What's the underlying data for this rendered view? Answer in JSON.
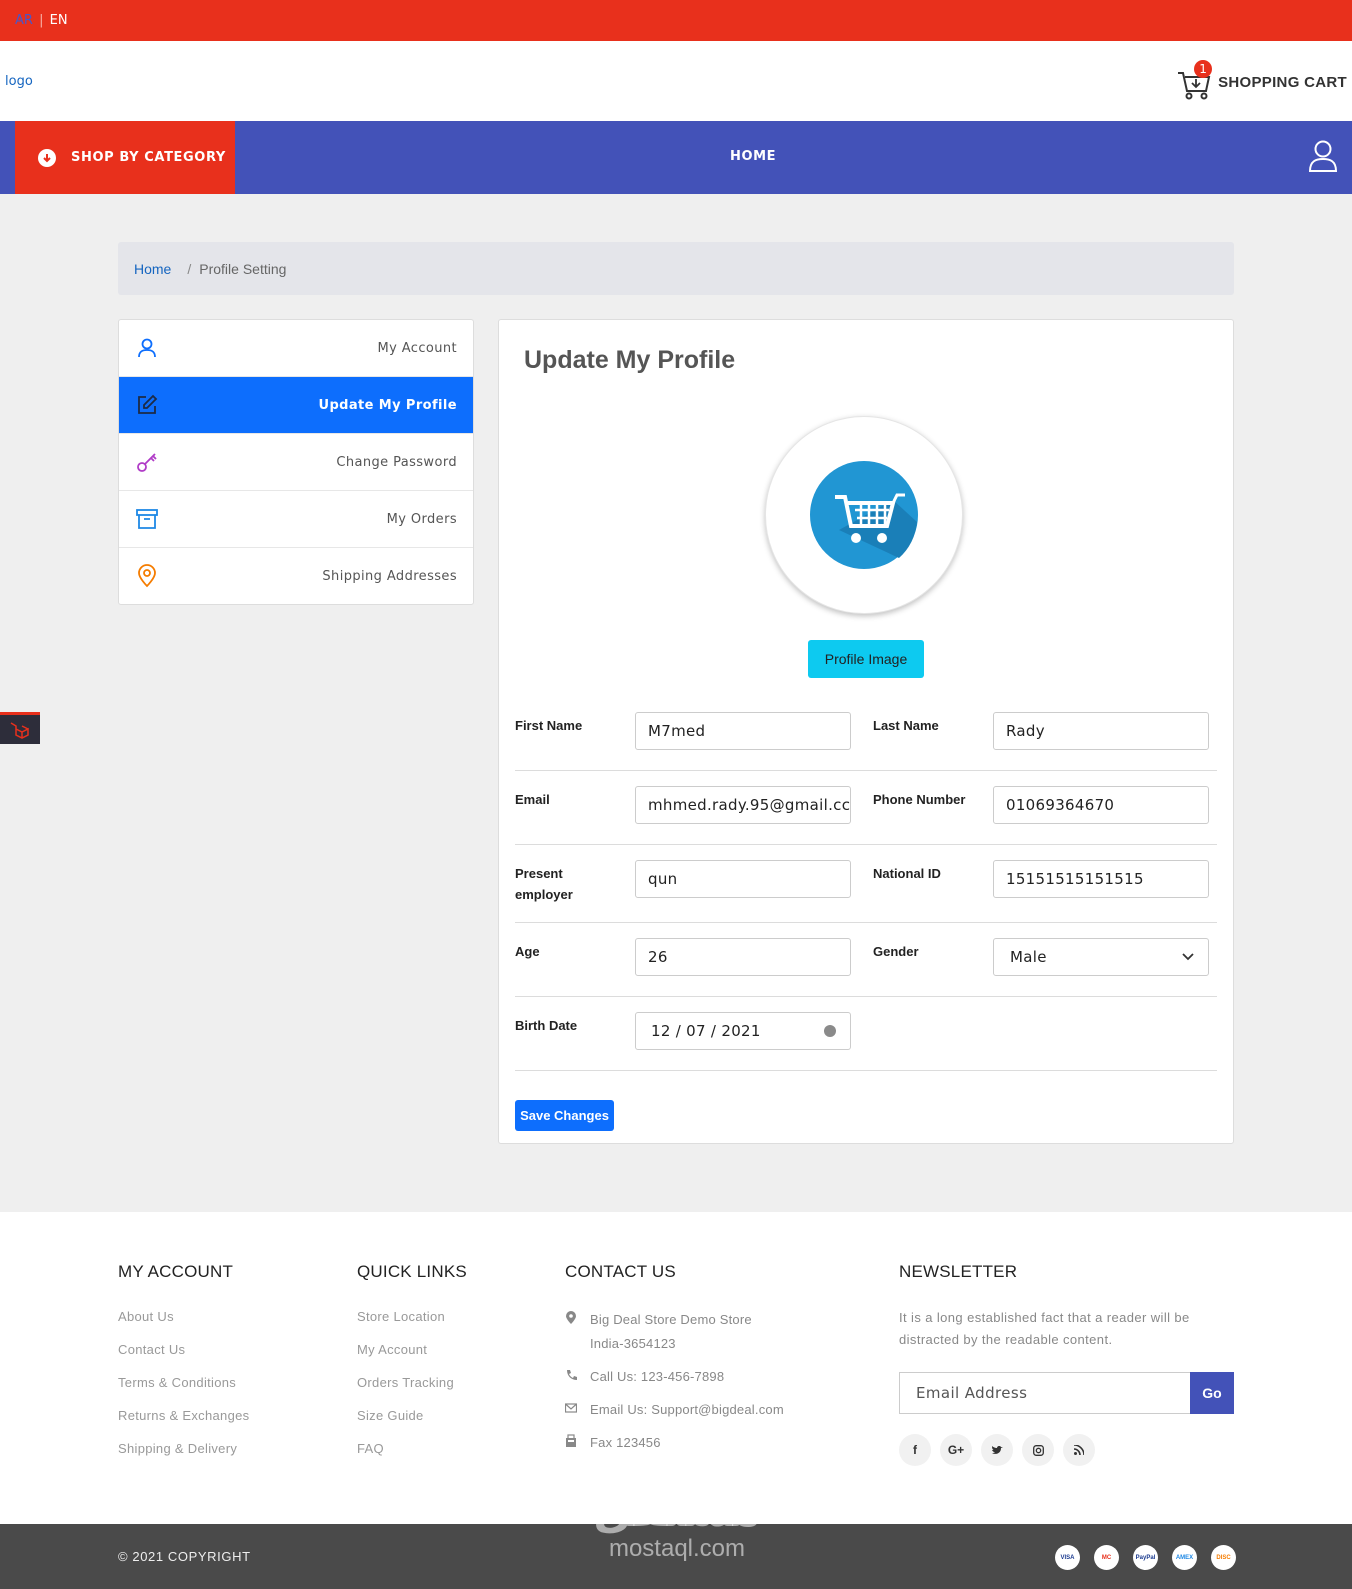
{
  "topbar": {
    "lang_ar": "AR",
    "lang_sep": "|",
    "lang_en": "EN"
  },
  "header": {
    "logo": "logo",
    "cart_count": "1",
    "cart_label": "SHOPPING CART"
  },
  "nav": {
    "shop_by_category": "SHOP BY CATEGORY",
    "home": "HOME"
  },
  "breadcrumb": {
    "home": "Home",
    "separator": "/",
    "current": "Profile Setting"
  },
  "sidebar": {
    "items": [
      {
        "label": "My Account",
        "icon": "user-icon",
        "active": false
      },
      {
        "label": "Update My Profile",
        "icon": "edit-icon",
        "active": true
      },
      {
        "label": "Change Password",
        "icon": "key-icon",
        "active": false
      },
      {
        "label": "My Orders",
        "icon": "archive-icon",
        "active": false
      },
      {
        "label": "Shipping Addresses",
        "icon": "map-pin-icon",
        "active": false
      }
    ]
  },
  "profile": {
    "title": "Update My Profile",
    "image_button": "Profile Image",
    "fields": {
      "first_name": {
        "label": "First Name",
        "value": "M7med"
      },
      "last_name": {
        "label": "Last Name",
        "value": "Rady"
      },
      "email": {
        "label": "Email",
        "value": "mhmed.rady.95@gmail.cc"
      },
      "phone": {
        "label": "Phone Number",
        "value": "01069364670"
      },
      "employer": {
        "label": "Present employer",
        "value": "qun"
      },
      "national_id": {
        "label": "National ID",
        "value": "15151515151515"
      },
      "age": {
        "label": "Age",
        "value": "26"
      },
      "gender": {
        "label": "Gender",
        "value": "Male"
      },
      "birth_date": {
        "label": "Birth Date",
        "value": "12 / 07 / 2021"
      }
    },
    "save_button": "Save Changes"
  },
  "footer": {
    "my_account": {
      "heading": "MY ACCOUNT",
      "links": [
        "About Us",
        "Contact Us",
        "Terms & Conditions",
        "Returns & Exchanges",
        "Shipping & Delivery"
      ]
    },
    "quick_links": {
      "heading": "QUICK LINKS",
      "links": [
        "Store Location",
        "My Account",
        "Orders Tracking",
        "Size Guide",
        "FAQ"
      ]
    },
    "contact": {
      "heading": "CONTACT US",
      "address_line1": "Big Deal Store Demo Store",
      "address_line2": "India-3654123",
      "phone": "Call Us: 123-456-7898",
      "email": "Email Us: Support@bigdeal.com",
      "fax": "Fax 123456"
    },
    "newsletter": {
      "heading": "NEWSLETTER",
      "text": "It is a long established fact that a reader will be distracted by the readable content.",
      "placeholder": "Email Address",
      "button": "Go",
      "socials": [
        "facebook-icon",
        "google-plus-icon",
        "twitter-icon",
        "instagram-icon",
        "rss-icon"
      ]
    }
  },
  "bottom": {
    "copyright": "© 2021 COPYRIGHT",
    "watermark_ar": "مستقل",
    "watermark_en": "mostaql.com",
    "payments": [
      "VISA",
      "MC",
      "PayPal",
      "AMEX",
      "DISC"
    ]
  },
  "colors": {
    "red": "#e8301c",
    "nav_blue": "#4352b8",
    "primary": "#0d6efd",
    "cyan": "#0dcaf0"
  }
}
